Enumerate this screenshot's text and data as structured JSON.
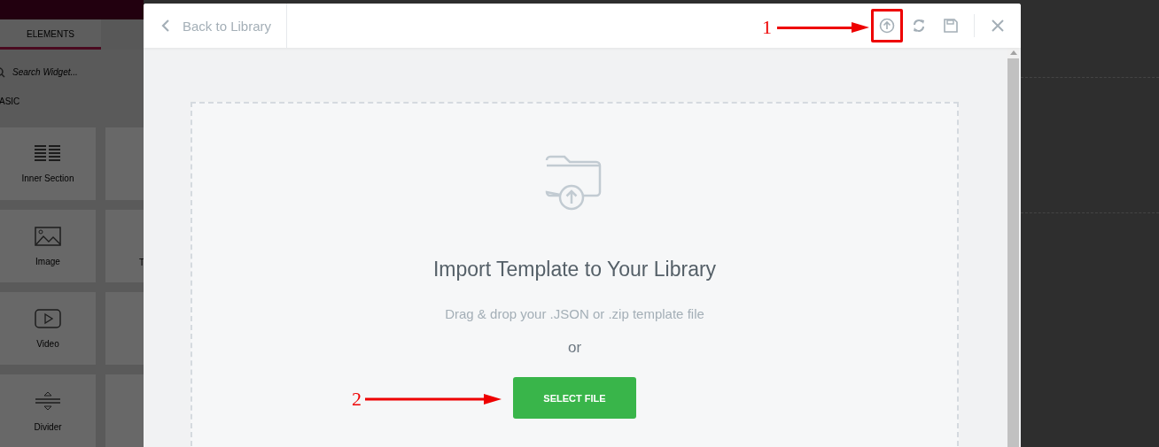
{
  "sidebar": {
    "tabs": [
      {
        "label": "ELEMENTS",
        "selected": true
      }
    ],
    "search": {
      "placeholder": "Search Widget..."
    },
    "category": "ASIC",
    "widgets": [
      {
        "label": "Inner Section",
        "kind": "columns"
      },
      {
        "label": "Image",
        "kind": "image",
        "neighbor_label": "T"
      },
      {
        "label": "Video",
        "kind": "video"
      },
      {
        "label": "Divider",
        "kind": "divider"
      }
    ]
  },
  "modal": {
    "back_label": "Back to Library",
    "actions": [
      {
        "kind": "import",
        "highlighted": true,
        "annotation": "1"
      },
      {
        "kind": "sync",
        "highlighted": false
      },
      {
        "kind": "save",
        "highlighted": false
      }
    ],
    "dropzone": {
      "title": "Import Template to Your Library",
      "hint": "Drag & drop your .JSON or .zip template file",
      "or": "or",
      "button": "SELECT FILE",
      "button_annotation": "2"
    }
  }
}
